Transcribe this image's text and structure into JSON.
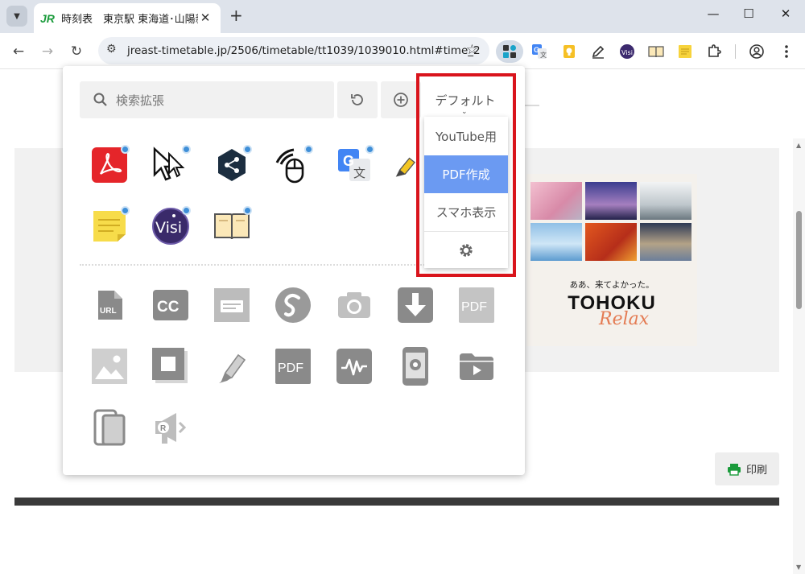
{
  "browser": {
    "tab": {
      "logo": "JR",
      "title": "時刻表　東京駅 東海道･山陽新",
      "close": "✕"
    },
    "new_tab": "+",
    "window_controls": {
      "minimize": "—",
      "maximize": "☐",
      "close": "✕"
    },
    "url": "jreast-timetable.jp/2506/timetable/tt1039/1039010.html#time_2",
    "extension_icons": [
      "extensions-manager-icon",
      "google-translate-icon",
      "keep-icon",
      "pen-icon",
      "visi-icon",
      "reader-icon",
      "sticky-note-icon",
      "puzzle-icon",
      "profile-icon",
      "more-icon"
    ]
  },
  "popup": {
    "search_placeholder": "検索拡張",
    "profile_dropdown": {
      "selected": "デフォルト",
      "options": [
        "YouTube用",
        "PDF作成",
        "スマホ表示"
      ],
      "highlighted": "PDF作成"
    },
    "enabled_extensions": [
      "adobe-acrobat-icon",
      "cursor-icon",
      "share-icon",
      "mouse-gesture-icon",
      "google-translate-icon",
      "highlighter-icon",
      "sticky-note-icon",
      "visi-icon",
      "reader-icon"
    ],
    "disabled_extensions": [
      "url-shortener-icon",
      "closed-caption-icon",
      "subtitle-icon",
      "screenshot-logo-icon",
      "camera-icon",
      "download-icon",
      "pdf-icon",
      "image-icon",
      "frame-icon",
      "marker-icon",
      "pdf-converter-icon",
      "audio-wave-icon",
      "phone-mirror-icon",
      "folder-video-icon",
      "devices-icon",
      "read-aloud-icon"
    ]
  },
  "page": {
    "ad": {
      "tagline": "ああ、来てよかった。",
      "brand": "TOHOKU",
      "script": "Relax"
    },
    "print_label": "印刷"
  },
  "colors": {
    "highlight_border": "#d9141c",
    "selected_item": "#6b9af2",
    "jr_green": "#1a9b3b"
  }
}
